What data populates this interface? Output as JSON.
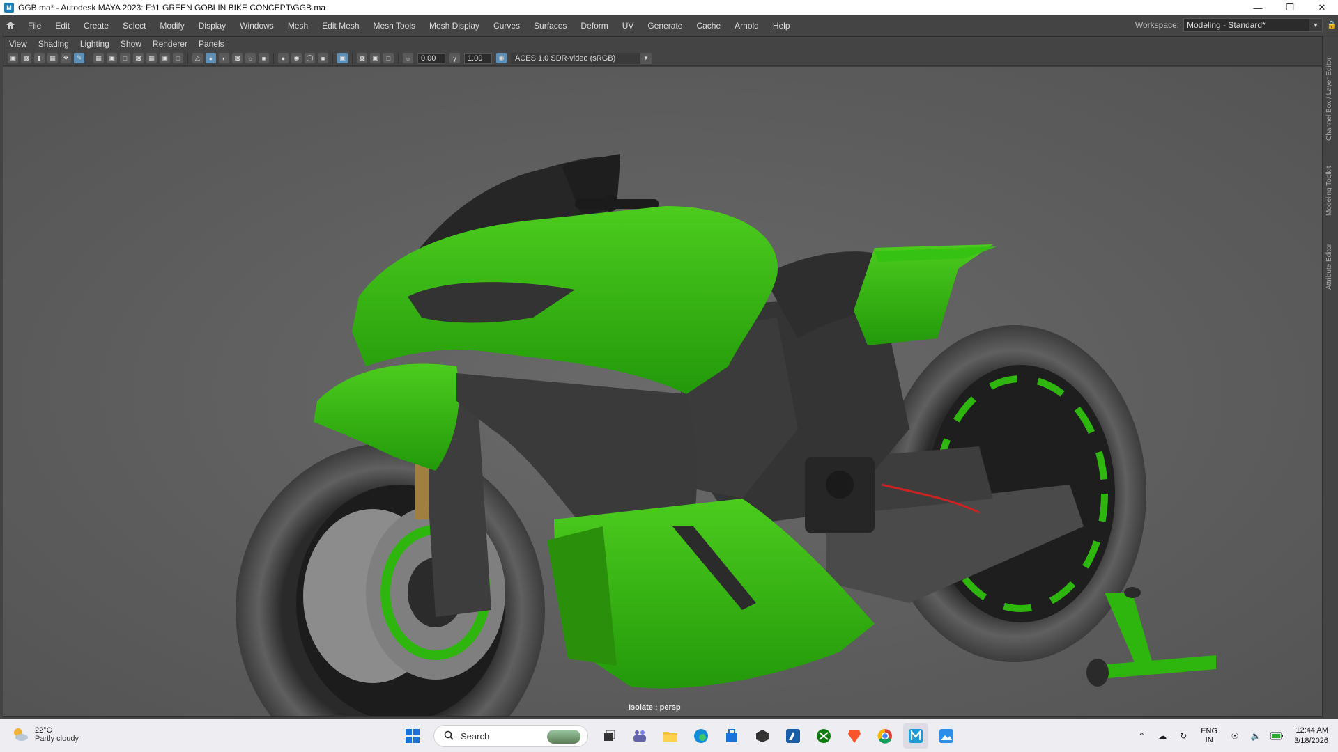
{
  "window": {
    "title": "GGB.ma* - Autodesk MAYA 2023: F:\\1 GREEN GOBLIN BIKE CONCEPT\\GGB.ma",
    "icon_label": "M"
  },
  "menu": {
    "items": [
      "File",
      "Edit",
      "Create",
      "Select",
      "Modify",
      "Display",
      "Windows",
      "Mesh",
      "Edit Mesh",
      "Mesh Tools",
      "Mesh Display",
      "Curves",
      "Surfaces",
      "Deform",
      "UV",
      "Generate",
      "Cache",
      "Arnold",
      "Help"
    ],
    "workspace_label": "Workspace:",
    "workspace_value": "Modeling - Standard*"
  },
  "panel": {
    "menu": [
      "View",
      "Shading",
      "Lighting",
      "Show",
      "Renderer",
      "Panels"
    ],
    "exposure": "0.00",
    "gamma": "1.00",
    "color_space": "ACES 1.0 SDR-video (sRGB)",
    "status": "Isolate : persp"
  },
  "sidetabs": [
    "Channel Box / Layer Editor",
    "Modeling Toolkit",
    "Attribute Editor"
  ],
  "colors": {
    "body_green": "#2fb60e",
    "dark_part": "#3a3a3a",
    "viewport_bg": "#5b5b5b"
  },
  "taskbar": {
    "weather_temp": "22°C",
    "weather_cond": "Partly cloudy",
    "search_placeholder": "Search",
    "lang_top": "ENG",
    "lang_bottom": "IN",
    "time": "12:44 AM",
    "date": "3/18/2026"
  }
}
